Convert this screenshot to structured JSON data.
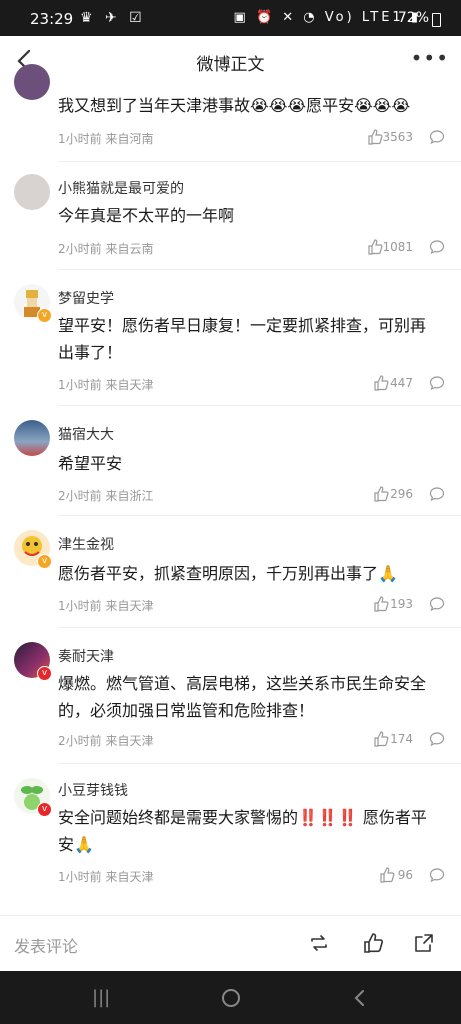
{
  "status_bar": {
    "time": "23:29",
    "battery": "72%",
    "network": "Vo) LTE1"
  },
  "header": {
    "title": "微博正文"
  },
  "comments": [
    {
      "username": "",
      "text": "我又想到了当年天津港事故😭😭😭愿平安😭😭😭",
      "meta": "1小时前 来自河南",
      "likes": "3563"
    },
    {
      "username": "小熊猫就是最可爱的",
      "text": "今年真是不太平的一年啊",
      "meta": "2小时前 来自云南",
      "likes": "1081"
    },
    {
      "username": "梦留史学",
      "text": "望平安！愿伤者早日康复！一定要抓紧排查，可别再出事了！",
      "meta": "1小时前 来自天津",
      "likes": "447"
    },
    {
      "username": "猫宿大大",
      "text": "希望平安",
      "meta": "2小时前 来自浙江",
      "likes": "296"
    },
    {
      "username": "津生金视",
      "text": "愿伤者平安，抓紧查明原因，千万别再出事了🙏",
      "meta": "1小时前 来自天津",
      "likes": "193"
    },
    {
      "username": "奏耐天津",
      "text": "爆燃。燃气管道、高层电梯，这些关系市民生命安全的，必须加强日常监管和危险排查！",
      "meta": "2小时前 来自天津",
      "likes": "174"
    },
    {
      "username": "小豆芽钱钱",
      "text": "安全问题始终都是需要大家警惕的‼️‼️‼️ 愿伤者平安🙏",
      "meta": "1小时前 来自天津",
      "likes": "96"
    }
  ],
  "bottom_bar": {
    "comment_placeholder": "发表评论"
  },
  "colors": {
    "status_bg": "#1a1a1a",
    "meta_gray": "#999999",
    "badge_orange": "#f6a623",
    "badge_red": "#e6282b"
  }
}
